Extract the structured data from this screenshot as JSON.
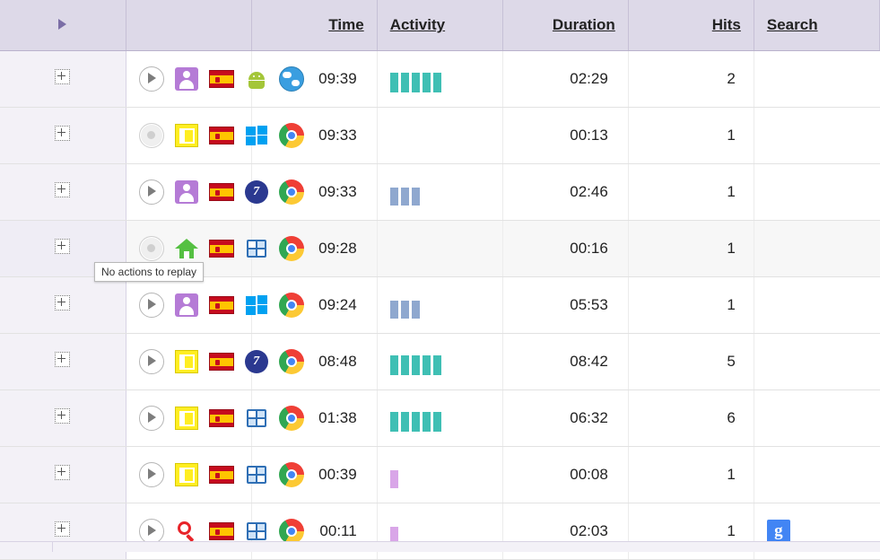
{
  "header": {
    "expander_icon": "play-triangle-icon",
    "columns": [
      {
        "key": "expander",
        "label": ""
      },
      {
        "key": "icons",
        "label": ""
      },
      {
        "key": "time",
        "label": "Time"
      },
      {
        "key": "activity",
        "label": "Activity"
      },
      {
        "key": "duration",
        "label": "Duration"
      },
      {
        "key": "hits",
        "label": "Hits"
      },
      {
        "key": "search",
        "label": "Search"
      }
    ]
  },
  "tooltip": {
    "text": "No actions to replay"
  },
  "rows": [
    {
      "play": {
        "icon": "play-icon",
        "enabled": true
      },
      "type_icon": "visitor-person-icon",
      "flag_icon": "flag-spain-icon",
      "os_icon": "android-icon",
      "browser_icon": "globe-browser-icon",
      "time": "09:39",
      "time_muted": true,
      "activity": {
        "color": "#3fbfb4",
        "bars": [
          22,
          22,
          22,
          22,
          22
        ]
      },
      "duration": "02:29",
      "duration_muted": true,
      "hits": "2",
      "hits_muted": true,
      "search_badge": "",
      "highlight": false
    },
    {
      "play": {
        "icon": "play-disabled-icon",
        "enabled": false
      },
      "type_icon": "window-icon",
      "flag_icon": "flag-spain-icon",
      "os_icon": "windows-8-icon",
      "browser_icon": "chrome-icon",
      "time": "09:33",
      "time_muted": false,
      "activity": {
        "color": "",
        "bars": []
      },
      "duration": "00:13",
      "duration_muted": false,
      "hits": "1",
      "hits_muted": false,
      "search_badge": "",
      "highlight": false
    },
    {
      "play": {
        "icon": "play-icon",
        "enabled": true
      },
      "type_icon": "visitor-person-icon",
      "flag_icon": "flag-spain-icon",
      "os_icon": "ie7-icon",
      "browser_icon": "chrome-icon",
      "time": "09:33",
      "time_muted": false,
      "activity": {
        "color": "#8fa8cf",
        "bars": [
          20,
          20,
          20
        ]
      },
      "duration": "02:46",
      "duration_muted": false,
      "hits": "1",
      "hits_muted": false,
      "search_badge": "",
      "highlight": false
    },
    {
      "play": {
        "icon": "play-disabled-icon",
        "enabled": false
      },
      "type_icon": "home-icon",
      "flag_icon": "flag-spain-icon",
      "os_icon": "windows-flag-icon",
      "browser_icon": "chrome-icon",
      "time": "09:28",
      "time_muted": false,
      "activity": {
        "color": "",
        "bars": []
      },
      "duration": "00:16",
      "duration_muted": false,
      "hits": "1",
      "hits_muted": false,
      "search_badge": "",
      "highlight": true
    },
    {
      "play": {
        "icon": "play-icon",
        "enabled": true
      },
      "type_icon": "visitor-person-icon",
      "flag_icon": "flag-spain-icon",
      "os_icon": "windows-8-icon",
      "browser_icon": "chrome-icon",
      "time": "09:24",
      "time_muted": false,
      "activity": {
        "color": "#8fa8cf",
        "bars": [
          20,
          20,
          20
        ]
      },
      "duration": "05:53",
      "duration_muted": false,
      "hits": "1",
      "hits_muted": false,
      "search_badge": "",
      "highlight": false
    },
    {
      "play": {
        "icon": "play-icon",
        "enabled": true
      },
      "type_icon": "window-icon",
      "flag_icon": "flag-spain-icon",
      "os_icon": "ie7-icon",
      "browser_icon": "chrome-icon",
      "time": "08:48",
      "time_muted": true,
      "activity": {
        "color": "#3fbfb4",
        "bars": [
          22,
          22,
          22,
          22,
          22
        ]
      },
      "duration": "08:42",
      "duration_muted": true,
      "hits": "5",
      "hits_muted": true,
      "search_badge": "",
      "highlight": false
    },
    {
      "play": {
        "icon": "play-icon",
        "enabled": true
      },
      "type_icon": "window-icon",
      "flag_icon": "flag-spain-icon",
      "os_icon": "windows-flag-icon",
      "browser_icon": "chrome-icon",
      "time": "01:38",
      "time_muted": true,
      "activity": {
        "color": "#3fbfb4",
        "bars": [
          22,
          22,
          22,
          22,
          22
        ]
      },
      "duration": "06:32",
      "duration_muted": true,
      "hits": "6",
      "hits_muted": true,
      "search_badge": "",
      "highlight": false
    },
    {
      "play": {
        "icon": "play-icon",
        "enabled": true
      },
      "type_icon": "window-icon",
      "flag_icon": "flag-spain-icon",
      "os_icon": "windows-flag-icon",
      "browser_icon": "chrome-icon",
      "time": "00:39",
      "time_muted": false,
      "activity": {
        "color": "#d9a6e8",
        "bars": [
          20
        ]
      },
      "duration": "00:08",
      "duration_muted": false,
      "hits": "1",
      "hits_muted": false,
      "search_badge": "",
      "highlight": false
    },
    {
      "play": {
        "icon": "play-icon",
        "enabled": true
      },
      "type_icon": "magnifier-icon",
      "flag_icon": "flag-spain-icon",
      "os_icon": "windows-flag-icon",
      "browser_icon": "chrome-icon",
      "time": "00:11",
      "time_muted": false,
      "activity": {
        "color": "#d9a6e8",
        "bars": [
          20
        ]
      },
      "duration": "02:03",
      "duration_muted": false,
      "hits": "1",
      "hits_muted": false,
      "search_badge": "g",
      "highlight": false
    }
  ]
}
